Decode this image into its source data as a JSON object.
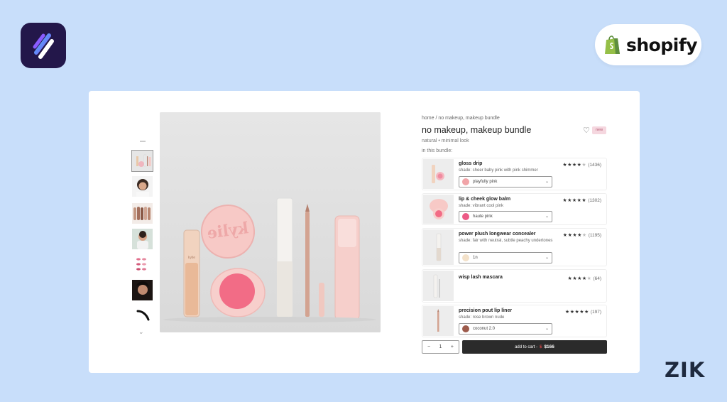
{
  "brand": {
    "shopify_label": "shopify",
    "corner_label": "ZIK"
  },
  "product": {
    "breadcrumb": "home / no makeup, makeup bundle",
    "title": "no makeup, makeup bundle",
    "badge": "new",
    "subtitle": "natural • minimal look",
    "bundle_label": "in this bundle:",
    "hero_logo_text": "kylie"
  },
  "items": [
    {
      "name": "gloss drip",
      "shade": "shade: sheer baby pink with pink shimmer",
      "rating": 4,
      "count": "(1436)",
      "selected": "playfully pink",
      "swatch": "#f1a4a8"
    },
    {
      "name": "lip & cheek glow balm",
      "shade": "shade: vibrant cool pink",
      "rating": 5,
      "count": "(1302)",
      "selected": "haute pink",
      "swatch": "#ec5a86"
    },
    {
      "name": "power plush longwear concealer",
      "shade": "shade: fair with neutral, subtle peachy undertones",
      "rating": 4,
      "count": "(1195)",
      "selected": "1n",
      "swatch": "#f3e1c9"
    },
    {
      "name": "wisp lash mascara",
      "shade": "",
      "rating": 4,
      "count": "(64)",
      "selected": "",
      "swatch": ""
    },
    {
      "name": "precision pout lip liner",
      "shade": "shade: rose brown nude",
      "rating": 5,
      "count": "(197)",
      "selected": "coconut 2.0",
      "swatch": "#9c5a4b"
    }
  ],
  "cart": {
    "minus": "−",
    "quantity": "1",
    "plus": "+",
    "label": "add to cart -",
    "old_price": "$",
    "price": "$166"
  },
  "colors": {
    "background": "#c8defa",
    "button": "#2b2b2b",
    "app_logo_bg": "#23174a",
    "shopify_green": "#95bf47"
  }
}
